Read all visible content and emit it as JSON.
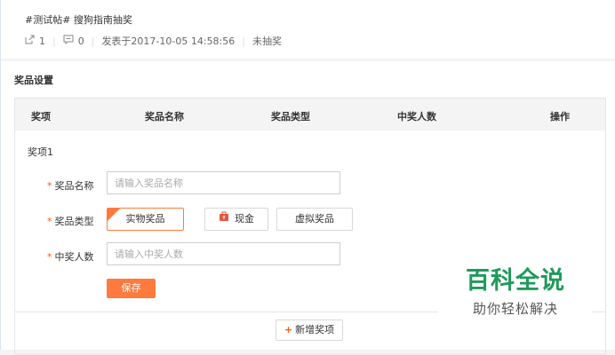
{
  "post": {
    "title": "#测试帖# 搜狗指南抽奖",
    "share_count": "1",
    "comment_count": "0",
    "published": "发表于2017-10-05 14:58:56",
    "status": "未抽奖"
  },
  "section_title": "奖品设置",
  "table": {
    "headers": [
      "奖项",
      "奖品名称",
      "奖品类型",
      "中奖人数",
      "操作"
    ]
  },
  "prize": {
    "heading": "奖项1",
    "name_label": "奖品名称",
    "name_placeholder": "请输入奖品名称",
    "type_label": "奖品类型",
    "type_options": [
      "实物奖品",
      "现金",
      "虚拟奖品"
    ],
    "selected_type": "实物奖品",
    "winners_label": "中奖人数",
    "winners_placeholder": "请输入中奖人数",
    "required_mark": "*",
    "save_label": "保存"
  },
  "add_prize_label": "新增奖项",
  "watermark": {
    "title": "百科全说",
    "subtitle": "助你轻松解决"
  },
  "colors": {
    "accent": "#ff5a00",
    "save_button": "#ff7a3d",
    "header_bg": "#f4f4f4",
    "watermark_green": "#1f9a5a"
  }
}
